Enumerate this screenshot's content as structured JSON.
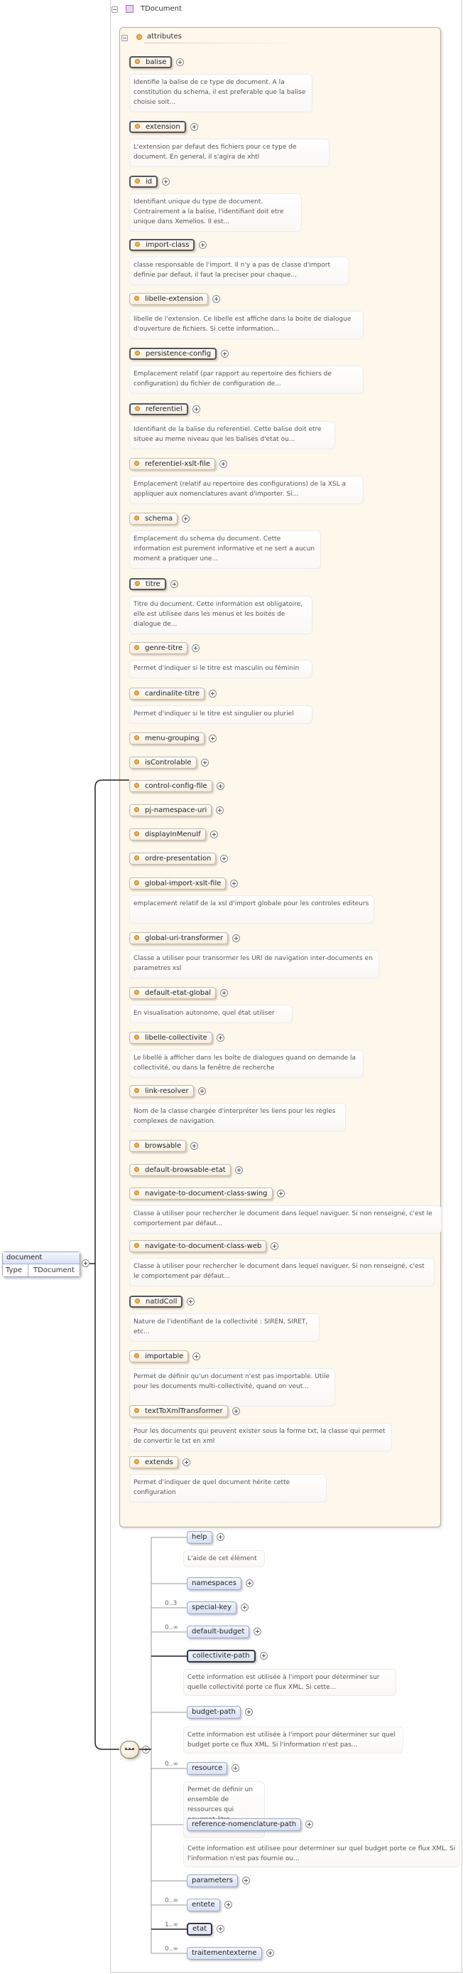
{
  "type_name": "TDocument",
  "attributes_title": "attributes",
  "root": {
    "name": "document",
    "type_label": "Type",
    "type_value": "TDocument"
  },
  "attributes": [
    {
      "name": "balise",
      "required": true,
      "desc": "Identifie la balise de ce type de document. A la constitution du schema, il est preferable que la balise choisie soit..."
    },
    {
      "name": "extension",
      "required": true,
      "desc": "L'extension par defaut des fichiers pour ce type de document. En general, il s'agira de xhtl"
    },
    {
      "name": "id",
      "required": true,
      "desc": "Identifiant unique du type de document. Contrairement a la balise, l'identifiant doit etre unique dans Xemelios. Il est..."
    },
    {
      "name": "import-class",
      "required": true,
      "desc": "classe responsable de l'import. Il n'y a pas de classe d'import definie par defaut, il faut la preciser pour chaque..."
    },
    {
      "name": "libelle-extension",
      "required": false,
      "desc": "libelle de l'extension. Ce libelle est affiche dans la boite de dialogue d'ouverture de fichiers. Si cette information..."
    },
    {
      "name": "persistence-config",
      "required": true,
      "desc": "Emplacement relatif (par rapport au repertoire des fichiers de configuration) du fichier de configuration de..."
    },
    {
      "name": "referentiel",
      "required": true,
      "desc": "Identifiant de la balise du referentiel. Cette balise doit etre situee au meme niveau que les balises d'etat ou..."
    },
    {
      "name": "referentiel-xslt-file",
      "required": false,
      "desc": "Emplacement (relatif au repertoire des configurations) de la XSL a appliquer aux nomenclatures avant d'importer. Si..."
    },
    {
      "name": "schema",
      "required": false,
      "desc": "Emplacement du schema du document. Cette information est purement informative et ne sert a aucun moment a pratiquer une..."
    },
    {
      "name": "titre",
      "required": true,
      "desc": "Titre du document. Cette information est obligatoire, elle est utilisee dans les menus et les boites de dialogue de..."
    },
    {
      "name": "genre-titre",
      "required": false,
      "desc": "Permet d'indiquer si le titre est masculin ou féminin"
    },
    {
      "name": "cardinalite-titre",
      "required": false,
      "desc": "Permet d'indiquer si le titre est singulier ou pluriel"
    },
    {
      "name": "menu-grouping",
      "required": false,
      "desc": ""
    },
    {
      "name": "isControlable",
      "required": false,
      "desc": ""
    },
    {
      "name": "control-config-file",
      "required": false,
      "desc": ""
    },
    {
      "name": "pj-namespace-uri",
      "required": false,
      "desc": ""
    },
    {
      "name": "displayInMenuIf",
      "required": false,
      "desc": ""
    },
    {
      "name": "ordre-presentation",
      "required": false,
      "desc": ""
    },
    {
      "name": "global-import-xslt-file",
      "required": false,
      "desc": "emplacement relatif de la xsl d'import globale pour les controles editeurs"
    },
    {
      "name": "global-uri-transformer",
      "required": false,
      "desc": "Classe a utiliser pour transormer les URI de navigation inter-documents en parametres xsl"
    },
    {
      "name": "default-etat-global",
      "required": false,
      "desc": "En visualisation autonome, quel état utiliser"
    },
    {
      "name": "libelle-collectivite",
      "required": false,
      "desc": "Le libellé à afficher dans les boîte de dialogues quand on demande la collectivité, ou dans la fenêtre de recherche"
    },
    {
      "name": "link-resolver",
      "required": false,
      "desc": "Nom de la classe chargée d'interpréter les liens pour les règles complexes de navigation."
    },
    {
      "name": "browsable",
      "required": false,
      "desc": ""
    },
    {
      "name": "default-browsable-etat",
      "required": false,
      "desc": ""
    },
    {
      "name": "navigate-to-document-class-swing",
      "required": false,
      "desc": "Classe à utiliser pour rechercher le document dans lequel naviguer. Si non renseigné, c'est le comportement par défaut..."
    },
    {
      "name": "navigate-to-document-class-web",
      "required": false,
      "desc": "Classe à utiliser pour rechercher le document dans lequel naviguer. Si non renseigné, c'est le comportement par défaut..."
    },
    {
      "name": "natIdColl",
      "required": true,
      "desc": "Nature de l'identifiant de la collectivité : SIREN, SIRET, etc..."
    },
    {
      "name": "importable",
      "required": false,
      "desc": "Permet de définir qu'un document n'est pas importable. Utile pour les documents multi-collectivité, quand on veut..."
    },
    {
      "name": "textToXmlTransformer",
      "required": false,
      "desc": "Pour les documents qui peuvent exister sous la forme txt, la classe qui permet de convertir le txt en xml"
    },
    {
      "name": "extends",
      "required": false,
      "desc": "Permet d'indiquer de quel document hérite cette configuration"
    }
  ],
  "elements": [
    {
      "name": "help",
      "required": false,
      "occ": "",
      "desc": "L'aide de cet élément"
    },
    {
      "name": "namespaces",
      "required": false,
      "occ": "",
      "desc": ""
    },
    {
      "name": "special-key",
      "required": false,
      "occ": "0..3",
      "desc": ""
    },
    {
      "name": "default-budget",
      "required": false,
      "occ": "0..∞",
      "desc": ""
    },
    {
      "name": "collectivite-path",
      "required": true,
      "occ": "",
      "desc": "Cette information est utilisée à l'import pour déterminer sur quelle collectivité porte ce flux XML. Si cette..."
    },
    {
      "name": "budget-path",
      "required": false,
      "occ": "",
      "desc": "Cette information est utilisée à l'import pour déterminer sur quel budget porte ce flux XML. Si l'information n'est pas..."
    },
    {
      "name": "resource",
      "required": false,
      "occ": "0..∞",
      "desc": "Permet de définir un ensemble de ressources qui pourront être réutilisées ailleurs"
    },
    {
      "name": "reference-nomenclature-path",
      "required": false,
      "occ": "",
      "desc": "Cette information est utilisee pour determiner sur quel budget porte ce flux XML. Si l'information n'est pas fournie ou..."
    },
    {
      "name": "parameters",
      "required": false,
      "occ": "",
      "desc": ""
    },
    {
      "name": "entete",
      "required": false,
      "occ": "0..∞",
      "desc": ""
    },
    {
      "name": "etat",
      "required": true,
      "occ": "1..∞",
      "desc": ""
    },
    {
      "name": "traitementexterne",
      "required": false,
      "occ": "0..∞",
      "desc": ""
    }
  ]
}
